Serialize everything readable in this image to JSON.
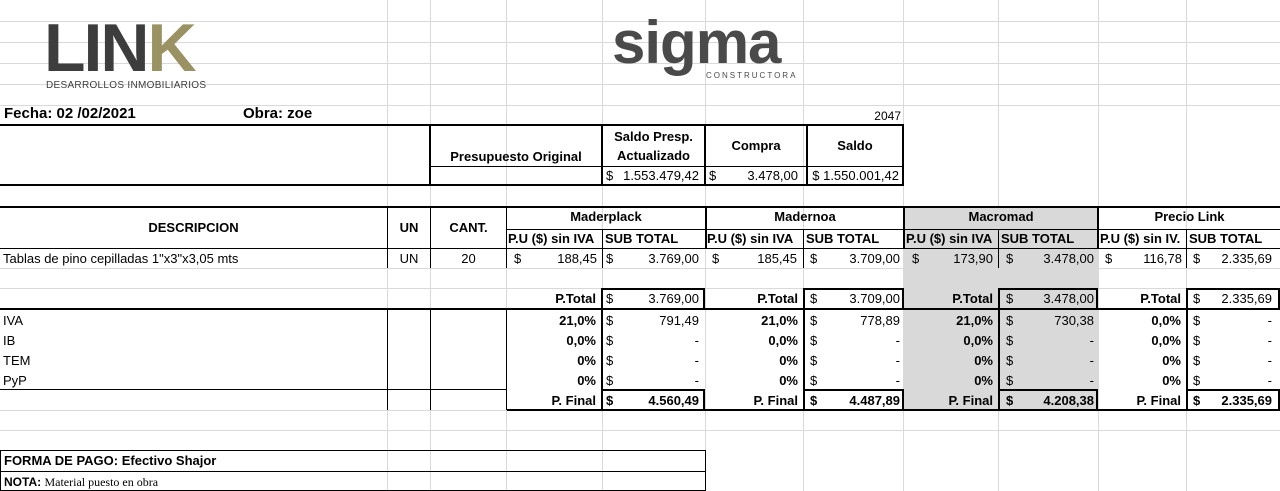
{
  "logos": {
    "link": "LINK",
    "link_sub": "DESARROLLOS INMOBILIARIOS",
    "sigma": "sigma",
    "sigma_sub": "CONSTRUCTORA"
  },
  "header": {
    "fecha": "Fecha: 02 /02/2021",
    "obra": "Obra: zoe",
    "code": "2047"
  },
  "budget": {
    "presupuesto_original": "Presupuesto Original",
    "saldo_presp_line1": "Saldo Presp.",
    "saldo_presp_line2": "Actualizado",
    "compra": "Compra",
    "saldo": "Saldo",
    "currency": "$",
    "saldo_presp_value": "1.553.479,42",
    "compra_value": "3.478,00",
    "saldo_value": "$ 1.550.001,42"
  },
  "table": {
    "descripcion": "DESCRIPCION",
    "un": "UN",
    "cant": "CANT.",
    "pu": "P.U ($) sin IVA",
    "pu_cut": "P.U ($) sin IV.",
    "subtotal": "SUB TOTAL",
    "item": {
      "desc": "Tablas de pino cepilladas 1\"x3\"x3,05 mts",
      "un": "UN",
      "cant": "20"
    },
    "labels": {
      "ptotal": "P.Total",
      "pfinal": "P. Final",
      "iva": "IVA",
      "ib": "IB",
      "tem": "TEM",
      "pyp": "PyP"
    },
    "suppliers": [
      {
        "name": "Maderplack",
        "pu": "188,45",
        "sub": "3.769,00",
        "ptotal": "3.769,00",
        "iva_pct": "21,0%",
        "iva": "791,49",
        "ib_pct": "0,0%",
        "ib": "-",
        "tem_pct": "0%",
        "tem": "-",
        "pyp_pct": "0%",
        "pyp": "-",
        "pfinal": "4.560,49"
      },
      {
        "name": "Madernoa",
        "pu": "185,45",
        "sub": "3.709,00",
        "ptotal": "3.709,00",
        "iva_pct": "21,0%",
        "iva": "778,89",
        "ib_pct": "0,0%",
        "ib": "-",
        "tem_pct": "0%",
        "tem": "-",
        "pyp_pct": "0%",
        "pyp": "-",
        "pfinal": "4.487,89"
      },
      {
        "name": "Macromad",
        "pu": "173,90",
        "sub": "3.478,00",
        "ptotal": "3.478,00",
        "iva_pct": "21,0%",
        "iva": "730,38",
        "ib_pct": "0,0%",
        "ib": "-",
        "tem_pct": "0%",
        "tem": "-",
        "pyp_pct": "0%",
        "pyp": "-",
        "pfinal": "4.208,38",
        "highlight_color": "#d9d9d9"
      },
      {
        "name": "Precio Link",
        "pu": "116,78",
        "sub": "2.335,69",
        "ptotal": "2.335,69",
        "iva_pct": "0,0%",
        "iva": "-",
        "ib_pct": "0,0%",
        "ib": "-",
        "tem_pct": "0%",
        "tem": "-",
        "pyp_pct": "0%",
        "pyp": "-",
        "pfinal": "2.335,69"
      }
    ]
  },
  "footer": {
    "forma_pago": "FORMA DE PAGO: Efectivo Shajor",
    "nota_label": "NOTA:",
    "nota_text": "Material puesto en obra"
  }
}
